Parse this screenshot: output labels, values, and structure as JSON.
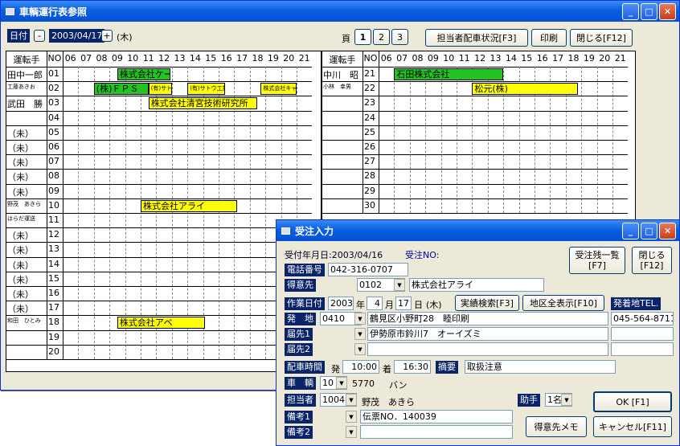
{
  "main_window": {
    "title": "車輌運行表参照"
  },
  "toolbar": {
    "date_label": "日付",
    "minus": "-",
    "date_value": "2003/04/17",
    "plus": "+",
    "weekday": "(木)",
    "page_label": "頁",
    "pages": [
      "1",
      "2",
      "3"
    ],
    "dispatch_button": "担当者配車状況[F3]",
    "print_button": "印刷",
    "close_button": "閉じる[F12]"
  },
  "grid": {
    "driver_header": "運転手",
    "no_header": "NO",
    "hours": [
      "06",
      "07",
      "08",
      "09",
      "10",
      "11",
      "12",
      "13",
      "14",
      "15",
      "16",
      "17",
      "18",
      "19",
      "20",
      "21"
    ],
    "left_rows": [
      {
        "driver": "田中一郎",
        "no": "01"
      },
      {
        "driver": "工藤あきお",
        "no": "02"
      },
      {
        "driver": "武田　勝",
        "no": "03"
      },
      {
        "driver": "",
        "no": "04"
      },
      {
        "driver": "（未）",
        "no": "05"
      },
      {
        "driver": "（未）",
        "no": "06"
      },
      {
        "driver": "（未）",
        "no": "07"
      },
      {
        "driver": "（未）",
        "no": "08"
      },
      {
        "driver": "（未）",
        "no": "09"
      },
      {
        "driver": "野茂　あきら",
        "no": "10"
      },
      {
        "driver": "はらだ運送",
        "no": "11"
      },
      {
        "driver": "（未）",
        "no": "12"
      },
      {
        "driver": "（未）",
        "no": "13"
      },
      {
        "driver": "（未）",
        "no": "14"
      },
      {
        "driver": "（未）",
        "no": "15"
      },
      {
        "driver": "（未）",
        "no": "16"
      },
      {
        "driver": "（未）",
        "no": "17"
      },
      {
        "driver": "和田　ひとみ",
        "no": "18"
      },
      {
        "driver": "",
        "no": "19"
      },
      {
        "driver": "",
        "no": "20"
      }
    ],
    "right_rows": [
      {
        "driver": "中川　昭",
        "no": "21"
      },
      {
        "driver": "小林　幸男",
        "no": "22"
      },
      {
        "driver": "",
        "no": "23"
      },
      {
        "driver": "",
        "no": "24"
      },
      {
        "driver": "",
        "no": "25"
      },
      {
        "driver": "",
        "no": "26"
      },
      {
        "driver": "",
        "no": "27"
      },
      {
        "driver": "",
        "no": "28"
      },
      {
        "driver": "",
        "no": "29"
      },
      {
        "driver": "",
        "no": "30"
      }
    ],
    "left_bars": [
      {
        "row": 0,
        "start": 9.5,
        "end": 12.9,
        "color": "g",
        "label": "株式会社ケーブル"
      },
      {
        "row": 1,
        "start": 8,
        "end": 11.5,
        "color": "g",
        "label": "(株)ＦＰＳ"
      },
      {
        "row": 1,
        "start": 11.5,
        "end": 13,
        "color": "y",
        "label": "(有)サトウ工業"
      },
      {
        "row": 1,
        "start": 14,
        "end": 16.4,
        "color": "y",
        "label": "(有)サトウ工業"
      },
      {
        "row": 1,
        "start": 18.7,
        "end": 21,
        "color": "y",
        "label": "株式会社キャニー"
      },
      {
        "row": 2,
        "start": 11.5,
        "end": 18.5,
        "color": "y",
        "label": "株式会社清宮技術研究所"
      },
      {
        "row": 9,
        "start": 11,
        "end": 17.2,
        "color": "y",
        "label": "株式会社アライ"
      },
      {
        "row": 17,
        "start": 9.5,
        "end": 15.1,
        "color": "y",
        "label": "株式会社アベ"
      }
    ],
    "right_bars": [
      {
        "row": 0,
        "start": 7,
        "end": 14,
        "color": "g",
        "label": "石田株式会社"
      },
      {
        "row": 1,
        "start": 12,
        "end": 18.8,
        "color": "y",
        "label": "松元(株)"
      }
    ]
  },
  "order_window": {
    "title": "受注入力",
    "received_label": "受付年月日:",
    "received_date": "2003/04/16",
    "order_no_label": "受注NO:",
    "remaining_button": "受注残一覧\n[F7]",
    "close_button": "閉じる\n[F12]",
    "phone_label": "電話番号",
    "phone_value": "042-316-0707",
    "customer_label": "得意先",
    "customer_code": "0102",
    "customer_name": "株式会社アライ",
    "work_date_label": "作業日付",
    "year": "2003",
    "year_unit": "年",
    "month": "4",
    "month_unit": "月",
    "day": "17",
    "day_unit": "日",
    "weekday": "(木)",
    "history_button": "実績検索[F3]",
    "area_button": "地区全表示[F10]",
    "origin_tel_label": "発着地TEL.",
    "origin_label": "発　地",
    "origin_code": "0410",
    "origin_address": "鶴見区小野町28　睦印刷",
    "origin_tel": "045-564-8711",
    "dest1_label": "届先1",
    "dest1_address": "伊勢原市鈴川7　オーイズミ",
    "dest2_label": "届先2",
    "time_label": "配車時間",
    "depart_label": "発",
    "depart_time": "10:00",
    "arrive_label": "着",
    "arrive_time": "16:30",
    "note_label": "摘要",
    "note_value": "取扱注意",
    "vehicle_label": "車　輌",
    "vehicle_no": "10",
    "vehicle_plate": "5770",
    "vehicle_type": "バン",
    "staff_label": "担当者",
    "staff_code": "1004",
    "staff_name": "野茂　あきら",
    "helper_label": "助手",
    "helper_value": "1名",
    "ok_button": "OK [F1]",
    "remark1_label": "備考1",
    "remark1_value": "伝票NO．140039",
    "remark2_label": "備考2",
    "customer_memo_button": "得意先メモ",
    "cancel_button": "キャンセル[F11]"
  }
}
